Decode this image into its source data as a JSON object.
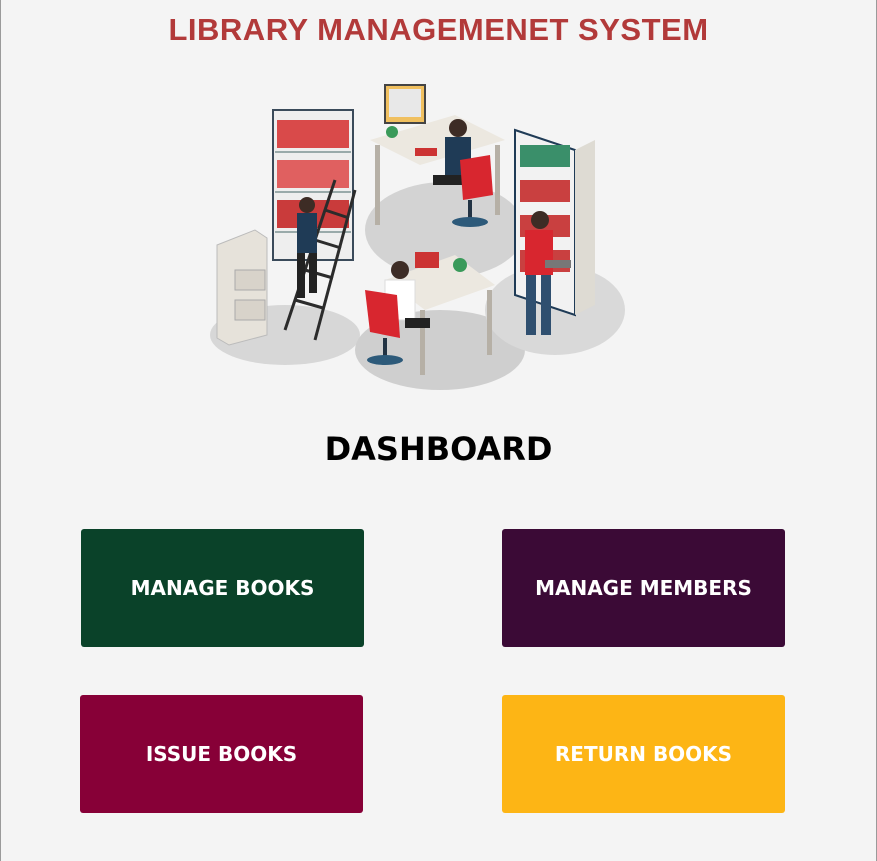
{
  "header": {
    "title": "LIBRARY MANAGEMENET SYSTEM"
  },
  "illustration": {
    "name": "library-illustration"
  },
  "dashboard": {
    "title": "DASHBOARD",
    "tiles": [
      {
        "label": "MANAGE BOOKS",
        "color": "#0a4229"
      },
      {
        "label": "MANAGE MEMBERS",
        "color": "#3b0a36"
      },
      {
        "label": "ISSUE BOOKS",
        "color": "#870037"
      },
      {
        "label": "RETURN BOOKS",
        "color": "#fdb515"
      }
    ]
  }
}
